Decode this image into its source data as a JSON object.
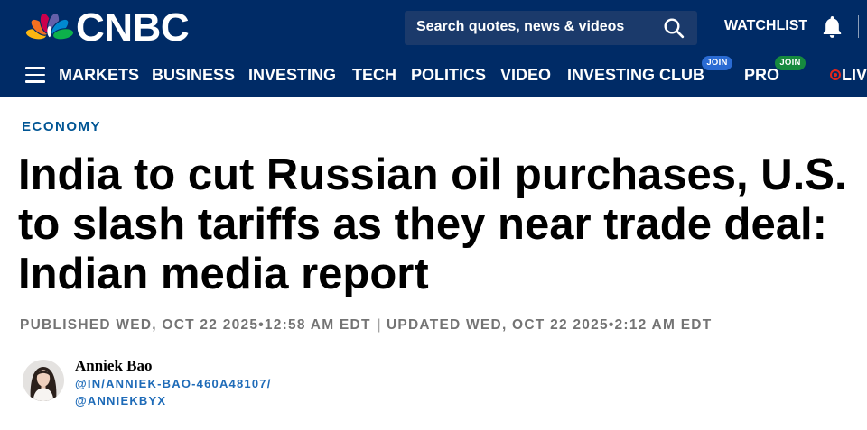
{
  "theme": {
    "header_bg": "#002b66",
    "search_bg": "#1b3a6b",
    "section_color": "#005594",
    "meta_color": "#747474",
    "author_link_color": "#1e6bb8",
    "investing_club_badge": "#2a6bd3",
    "pro_badge": "#168a3e",
    "live_dot": "#e1261c"
  },
  "brand": {
    "logo_text": "CNBC",
    "logo_icon": "nbc-peacock-icon",
    "peacock_colors": [
      "#fcb711",
      "#f37021",
      "#cc004c",
      "#6460aa",
      "#0089d0",
      "#0db14b"
    ]
  },
  "search": {
    "placeholder": "Search quotes, news & videos",
    "icon": "search-icon"
  },
  "watchlist": {
    "label": "WATCHLIST",
    "icon": "bell-icon"
  },
  "nav": {
    "menu_icon": "hamburger-menu-icon",
    "items": [
      {
        "label": "MARKETS"
      },
      {
        "label": "BUSINESS"
      },
      {
        "label": "INVESTING"
      },
      {
        "label": "TECH"
      },
      {
        "label": "POLITICS"
      },
      {
        "label": "VIDEO"
      },
      {
        "label": "INVESTING CLUB",
        "badge": "JOIN"
      },
      {
        "label": "PRO",
        "badge": "JOIN"
      },
      {
        "label": "LIV",
        "live": true
      }
    ]
  },
  "article": {
    "section": "ECONOMY",
    "headline": "India to cut Russian oil purchases, U.S. to slash tariffs as they near trade deal: Indian media report",
    "published": "PUBLISHED WED, OCT 22 2025•12:58 AM EDT",
    "separator": "|",
    "updated": "UPDATED WED, OCT 22 2025•2:12 AM EDT",
    "author": {
      "name": "Anniek Bao",
      "linkedin": "@IN/ANNIEK-BAO-460A48107/",
      "twitter": "@ANNIEKBYX"
    }
  }
}
